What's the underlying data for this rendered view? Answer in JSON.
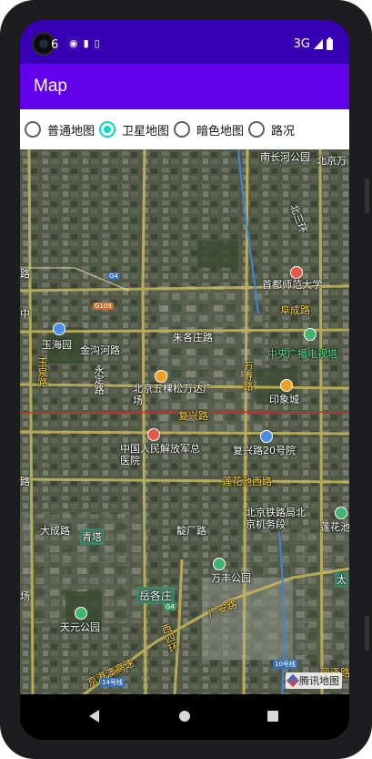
{
  "statusbar": {
    "time": "6",
    "network": "3G",
    "notification_icons": [
      "chat-icon",
      "sd-card-icon",
      "storage-icon"
    ]
  },
  "appbar": {
    "title": "Map",
    "color": "#6200ee"
  },
  "statusbar_color": "#3700b3",
  "map_types": {
    "options": [
      "普通地图",
      "卫星地图",
      "暗色地图",
      "路况"
    ],
    "selected": "卫星地图",
    "accent": "#03dac5"
  },
  "map": {
    "labels": {
      "nanchanghe": "南长河公园",
      "beijing_wan": "北京万",
      "beisanhuan": "北三环",
      "road_lu": "路",
      "g4_badge": "G4",
      "g109_badge": "G109",
      "shoudu_shifan": "首都师范大学",
      "zhongcheng": "中",
      "fuchenglu": "阜成路",
      "yuhaiyuan": "玉海园",
      "jingouhe": "金沟河路",
      "zhuge": "朱各庄路",
      "cctv": "中央广播电视塔",
      "yuquan": "玉泉路",
      "yongding": "永定路",
      "wukesong": "北京五棵松万达广场",
      "wanshou": "万寿路",
      "yinxiang": "印象城",
      "fuxinglu": "复兴路",
      "pla": "中国人民解放军总医院",
      "fuxing20": "复兴路20号院",
      "lianhuachi_xi": "莲花池西路",
      "lu_left": "路",
      "tielu": "北京铁路局北京机务段",
      "dacheng": "大成路",
      "qingta": "青塔",
      "dianlu": "靛厂路",
      "lianhuachi_r": "莲花池",
      "wanfeng": "万丰公园",
      "yuegezhuang": "岳各庄",
      "chang": "场",
      "guanganlu": "广安路",
      "tianyuan": "天元公园",
      "jinggang": "京港澳高速",
      "xisihuan": "西四环",
      "line10": "10号线",
      "line14": "14号线",
      "lize": "丽泽路",
      "tai": "太"
    },
    "watermark": "腾讯地图"
  }
}
